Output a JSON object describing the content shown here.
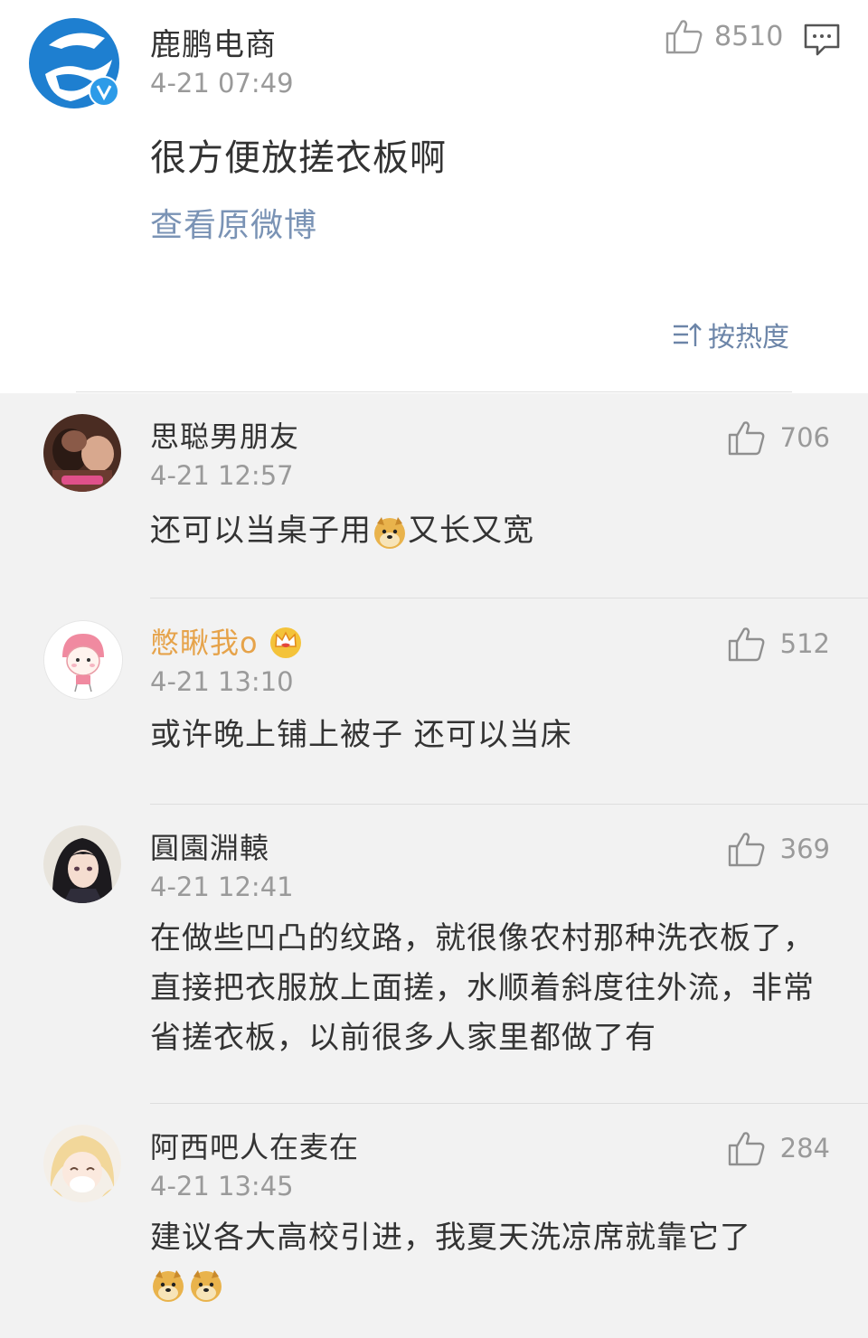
{
  "original": {
    "author": "鹿鹏电商",
    "time": "4-21 07:49",
    "likes": "8510",
    "text": "很方便放搓衣板啊",
    "view_original": "查看原微博",
    "sort_label": "按热度"
  },
  "comments": [
    {
      "name": "思聪男朋友",
      "time": "4-21 12:57",
      "likes": "706",
      "text_a": "还可以当桌子用",
      "text_b": "又长又宽"
    },
    {
      "name": "憋瞅我o",
      "time": "4-21 13:10",
      "likes": "512",
      "text": "或许晚上铺上被子 还可以当床"
    },
    {
      "name": "圓園淵轅",
      "time": "4-21 12:41",
      "likes": "369",
      "text": "在做些凹凸的纹路，就很像农村那种洗衣板了，直接把衣服放上面搓，水顺着斜度往外流，非常省搓衣板，以前很多人家里都做了有"
    },
    {
      "name": "阿西吧人在麦在",
      "time": "4-21 13:45",
      "likes": "284",
      "text": "建议各大高校引进，我夏天洗凉席就靠它了"
    }
  ],
  "colors": {
    "link": "#7a93b5",
    "vip_name": "#e6a34a",
    "muted": "#9a9a9a",
    "verified_badge": "#2d9be8",
    "brand_blue": "#1e7fd0"
  },
  "icons": [
    "thumbs-up-icon",
    "comment-icon",
    "sort-icon",
    "verified-badge-icon",
    "crown-icon",
    "doge-emoji"
  ]
}
